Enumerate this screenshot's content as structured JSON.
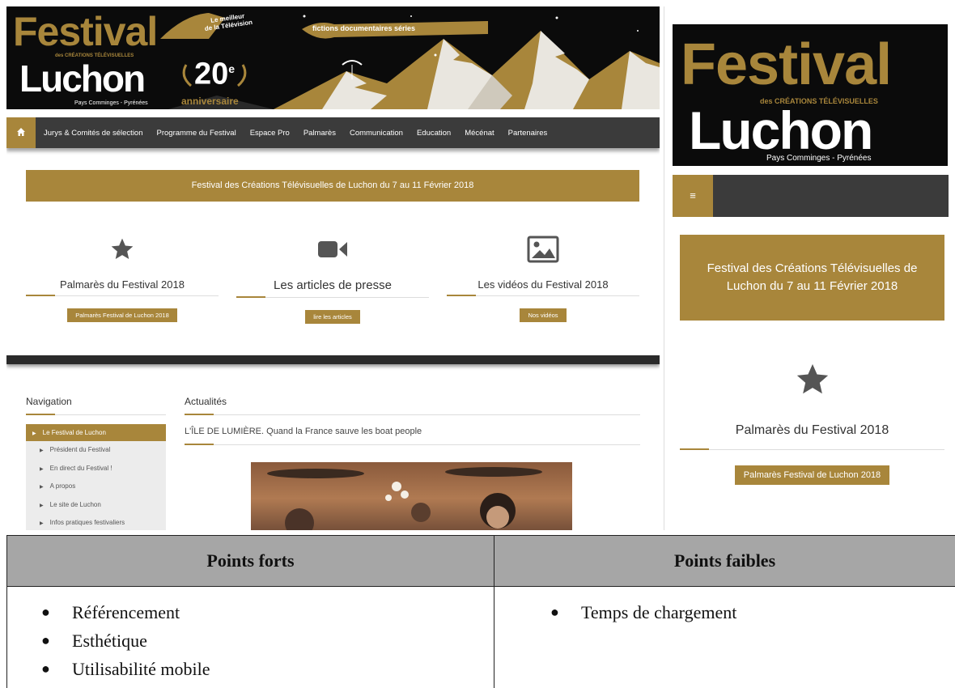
{
  "desktop": {
    "logo": {
      "festival": "Festival",
      "creations": "des CRÉATIONS TÉLÉVISUELLES",
      "luchon": "Luchon",
      "region": "Pays Comminges - Pyrénées"
    },
    "banner": {
      "meilleur_line1": "Le meilleur",
      "meilleur_line2": "de la Télévision",
      "genres": "fictions  documentaires  séries",
      "anniversary_number": "20",
      "anniversary_suffix": "e",
      "anniversary_word": "anniversaire"
    },
    "nav": {
      "home_icon": "home-icon",
      "items": [
        "Jurys & Comités de sélection",
        "Programme du Festival",
        "Espace Pro",
        "Palmarès",
        "Communication",
        "Education",
        "Mécénat",
        "Partenaires"
      ]
    },
    "date_banner": "Festival des Créations Télévisuelles de Luchon du 7 au 11 Février 2018",
    "features": [
      {
        "icon": "star-icon",
        "title": "Palmarès du Festival 2018",
        "button": "Palmarès Festival de Luchon 2018"
      },
      {
        "icon": "video-camera-icon",
        "title": "Les articles de presse",
        "button": "lire les articles"
      },
      {
        "icon": "image-icon",
        "title": "Les vidéos du Festival 2018",
        "button": "Nos vidéos"
      }
    ],
    "navigation": {
      "heading": "Navigation",
      "active": "Le Festival de Luchon",
      "items": [
        "Président du Festival",
        "En direct du Festival !",
        "A propos",
        "Le site de Luchon",
        "Infos pratiques festivaliers"
      ]
    },
    "actualites": {
      "heading": "Actualités",
      "article_title": "L'ÎLE DE LUMIÈRE. Quand la France sauve les boat people"
    }
  },
  "mobile": {
    "logo": {
      "festival": "Festival",
      "creations": "des CRÉATIONS TÉLÉVISUELLES",
      "luchon": "Luchon",
      "region": "Pays Comminges - Pyrénées"
    },
    "menu_icon": "hamburger-menu-icon",
    "date_banner": "Festival des Créations Télévisuelles de Luchon du 7 au 11 Février 2018",
    "feature": {
      "icon": "star-icon",
      "title": "Palmarès du Festival 2018",
      "button": "Palmarès Festival de Luchon 2018"
    }
  },
  "comparison": {
    "strengths_header": "Points forts",
    "weaknesses_header": "Points faibles",
    "strengths": [
      "Référencement",
      "Esthétique",
      "Utilisabilité mobile"
    ],
    "weaknesses": [
      "Temps de chargement"
    ]
  },
  "colors": {
    "gold": "#a8863b",
    "dark": "#0b0b0b",
    "nav_gray": "#3b3b3b",
    "table_header": "#a6a6a6"
  }
}
